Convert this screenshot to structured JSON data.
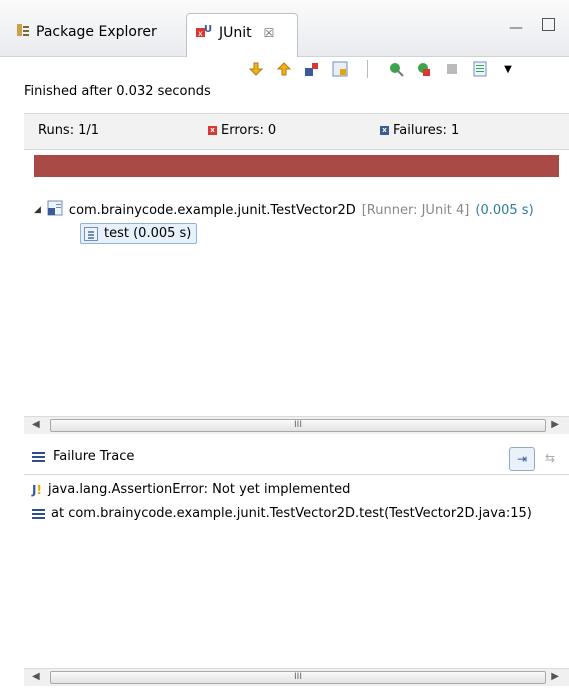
{
  "tabs": {
    "package_explorer": "Package Explorer",
    "junit": "JUnit",
    "close_glyph": "☒"
  },
  "window_controls": {
    "minimize": "—"
  },
  "toolbar": {
    "icons": [
      "next-failure-icon",
      "previous-failure-icon",
      "show-failures-only-icon",
      "scroll-lock-icon",
      "rerun-test-icon",
      "rerun-failed-first-icon",
      "stop-icon",
      "test-run-history-icon",
      "view-menu-icon"
    ]
  },
  "status": {
    "finished": "Finished after 0.032 seconds"
  },
  "counts": {
    "runs_label": "Runs:",
    "runs_value": "1/1",
    "errors_label": "Errors:",
    "errors_value": "0",
    "failures_label": "Failures:",
    "failures_value": "1",
    "bar_color": "#a94a47",
    "error_color": "#d9372f",
    "failure_color": "#3a5a9a"
  },
  "tree": {
    "suite_name": "com.brainycode.example.junit.TestVector2D",
    "suite_runner": "[Runner: JUnit 4]",
    "suite_time": "(0.005 s)",
    "test_name": "test (0.005 s)"
  },
  "scrollbar": {
    "grip": "III",
    "left_arrow": "◀",
    "right_arrow": "▶"
  },
  "failure_trace": {
    "title": "Failure Trace",
    "lines": [
      "java.lang.AssertionError: Not yet implemented",
      "at com.brainycode.example.junit.TestVector2D.test(TestVector2D.java:15)"
    ]
  }
}
